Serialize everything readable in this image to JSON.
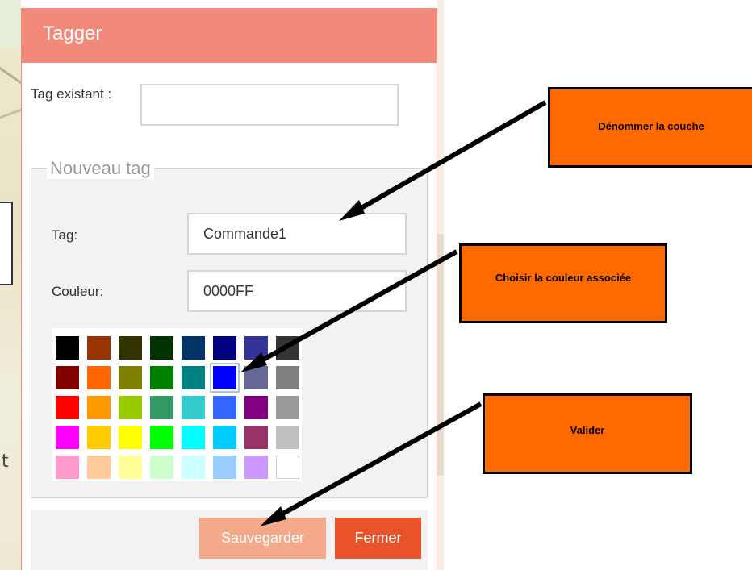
{
  "dialog": {
    "title": "Tagger",
    "existing_tag_label": "Tag existant :",
    "existing_tag_value": "",
    "new_tag_legend": "Nouveau tag",
    "tag_label": "Tag:",
    "tag_value": "Commande1",
    "color_label": "Couleur:",
    "color_value": "0000FF",
    "palette": [
      [
        "#000000",
        "#993300",
        "#333300",
        "#003300",
        "#003366",
        "#000080",
        "#333399",
        "#333333"
      ],
      [
        "#800000",
        "#FF6600",
        "#808000",
        "#008000",
        "#008080",
        "#0000FF",
        "#666699",
        "#808080"
      ],
      [
        "#FF0000",
        "#FF9900",
        "#99CC00",
        "#339966",
        "#33CCCC",
        "#3366FF",
        "#800080",
        "#999999"
      ],
      [
        "#FF00FF",
        "#FFCC00",
        "#FFFF00",
        "#00FF00",
        "#00FFFF",
        "#00CCFF",
        "#993366",
        "#C0C0C0"
      ],
      [
        "#FF99CC",
        "#FFCC99",
        "#FFFF99",
        "#CCFFCC",
        "#CCFFFF",
        "#99CCFF",
        "#CC99FF",
        "#FFFFFF"
      ]
    ],
    "selected_color": "#0000FF",
    "save_label": "Sauvegarder",
    "close_label": "Fermer"
  },
  "callouts": {
    "name_layer": "Dénommer la couche",
    "choose_color": "Choisir la couleur associée",
    "validate": "Valider"
  },
  "colors": {
    "header": "#f28a7b",
    "save_button": "#f4a98a",
    "close_button": "#e8532a",
    "callout": "#ff6a00"
  }
}
